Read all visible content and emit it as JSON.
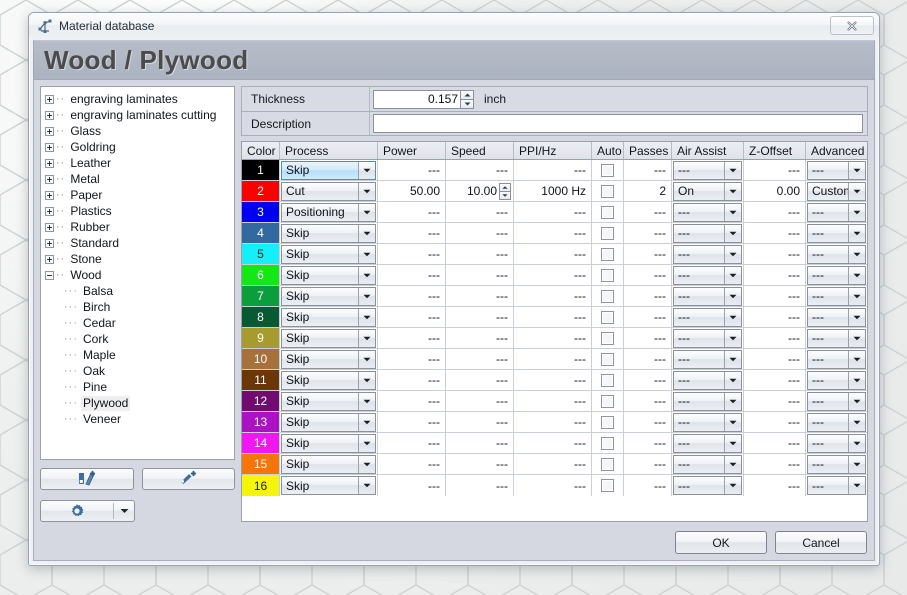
{
  "window": {
    "titlebar_text": "Material database",
    "titlebar_icon": "material-node-icon",
    "close_label": "Close",
    "close_icon": "close-x-icon"
  },
  "header": {
    "title": "Wood / Plywood"
  },
  "tree": {
    "roots": [
      {
        "label": "engraving laminates",
        "state": "collapsed"
      },
      {
        "label": "engraving laminates cutting",
        "state": "collapsed"
      },
      {
        "label": "Glass",
        "state": "collapsed"
      },
      {
        "label": "Goldring",
        "state": "collapsed"
      },
      {
        "label": "Leather",
        "state": "collapsed"
      },
      {
        "label": "Metal",
        "state": "collapsed"
      },
      {
        "label": "Paper",
        "state": "collapsed"
      },
      {
        "label": "Plastics",
        "state": "collapsed"
      },
      {
        "label": "Rubber",
        "state": "collapsed"
      },
      {
        "label": "Standard",
        "state": "collapsed"
      },
      {
        "label": "Stone",
        "state": "collapsed"
      },
      {
        "label": "Wood",
        "state": "expanded"
      }
    ],
    "children": [
      {
        "label": "Balsa",
        "selected": false
      },
      {
        "label": "Birch",
        "selected": false
      },
      {
        "label": "Cedar",
        "selected": false
      },
      {
        "label": "Cork",
        "selected": false
      },
      {
        "label": "Maple",
        "selected": false
      },
      {
        "label": "Oak",
        "selected": false
      },
      {
        "label": "Pine",
        "selected": false
      },
      {
        "label": "Plywood",
        "selected": true
      },
      {
        "label": "Veneer",
        "selected": false
      }
    ]
  },
  "left_buttons": {
    "new_material_icon": "new-material-icon",
    "new_setting_icon": "new-setting-icon",
    "options_icon": "gear-icon",
    "options_dropdown_icon": "chevron-down-icon"
  },
  "form": {
    "thickness_label": "Thickness",
    "thickness_value": "0.157",
    "thickness_unit": "inch",
    "description_label": "Description",
    "description_value": "",
    "spinner_up_icon": "spinner-up-icon",
    "spinner_down_icon": "spinner-down-icon"
  },
  "grid": {
    "columns": [
      "Color",
      "Process",
      "Power",
      "Speed",
      "PPI/Hz",
      "Auto",
      "Passes",
      "Air Assist",
      "Z-Offset",
      "Advanced"
    ],
    "placeholder": "---",
    "rows": [
      {
        "index": "1",
        "color": "#000000",
        "text_color": "#ffffff",
        "process": "Skip",
        "process_selected": true,
        "power": "---",
        "speed": "---",
        "speed_spinner": false,
        "ppi": "---",
        "auto": false,
        "passes": "---",
        "air_assist": "---",
        "z_offset": "---",
        "advanced": "---"
      },
      {
        "index": "2",
        "color": "#fa0000",
        "text_color": "#ffffff",
        "process": "Cut",
        "process_selected": false,
        "power": "50.00",
        "speed": "10.00",
        "speed_spinner": true,
        "ppi": "1000 Hz",
        "auto": false,
        "passes": "2",
        "air_assist": "On",
        "z_offset": "0.00",
        "advanced": "Custom"
      },
      {
        "index": "3",
        "color": "#0000f0",
        "text_color": "#ffffff",
        "process": "Positioning",
        "process_selected": false,
        "power": "---",
        "speed": "---",
        "speed_spinner": false,
        "ppi": "---",
        "auto": false,
        "passes": "---",
        "air_assist": "---",
        "z_offset": "---",
        "advanced": "---"
      },
      {
        "index": "4",
        "color": "#33699e",
        "text_color": "#ffffff",
        "process": "Skip",
        "process_selected": false,
        "power": "---",
        "speed": "---",
        "speed_spinner": false,
        "ppi": "---",
        "auto": false,
        "passes": "---",
        "air_assist": "---",
        "z_offset": "---",
        "advanced": "---"
      },
      {
        "index": "5",
        "color": "#15eff7",
        "text_color": "#222222",
        "process": "Skip",
        "process_selected": false,
        "power": "---",
        "speed": "---",
        "speed_spinner": false,
        "ppi": "---",
        "auto": false,
        "passes": "---",
        "air_assist": "---",
        "z_offset": "---",
        "advanced": "---"
      },
      {
        "index": "6",
        "color": "#13e716",
        "text_color": "#ffffff",
        "process": "Skip",
        "process_selected": false,
        "power": "---",
        "speed": "---",
        "speed_spinner": false,
        "ppi": "---",
        "auto": false,
        "passes": "---",
        "air_assist": "---",
        "z_offset": "---",
        "advanced": "---"
      },
      {
        "index": "7",
        "color": "#0c9e3c",
        "text_color": "#ffffff",
        "process": "Skip",
        "process_selected": false,
        "power": "---",
        "speed": "---",
        "speed_spinner": false,
        "ppi": "---",
        "auto": false,
        "passes": "---",
        "air_assist": "---",
        "z_offset": "---",
        "advanced": "---"
      },
      {
        "index": "8",
        "color": "#085a33",
        "text_color": "#ffffff",
        "process": "Skip",
        "process_selected": false,
        "power": "---",
        "speed": "---",
        "speed_spinner": false,
        "ppi": "---",
        "auto": false,
        "passes": "---",
        "air_assist": "---",
        "z_offset": "---",
        "advanced": "---"
      },
      {
        "index": "9",
        "color": "#a79b2e",
        "text_color": "#ffffff",
        "process": "Skip",
        "process_selected": false,
        "power": "---",
        "speed": "---",
        "speed_spinner": false,
        "ppi": "---",
        "auto": false,
        "passes": "---",
        "air_assist": "---",
        "z_offset": "---",
        "advanced": "---"
      },
      {
        "index": "10",
        "color": "#a7713c",
        "text_color": "#ffffff",
        "process": "Skip",
        "process_selected": false,
        "power": "---",
        "speed": "---",
        "speed_spinner": false,
        "ppi": "---",
        "auto": false,
        "passes": "---",
        "air_assist": "---",
        "z_offset": "---",
        "advanced": "---"
      },
      {
        "index": "11",
        "color": "#6b3708",
        "text_color": "#ffffff",
        "process": "Skip",
        "process_selected": false,
        "power": "---",
        "speed": "---",
        "speed_spinner": false,
        "ppi": "---",
        "auto": false,
        "passes": "---",
        "air_assist": "---",
        "z_offset": "---",
        "advanced": "---"
      },
      {
        "index": "12",
        "color": "#710a71",
        "text_color": "#ffffff",
        "process": "Skip",
        "process_selected": false,
        "power": "---",
        "speed": "---",
        "speed_spinner": false,
        "ppi": "---",
        "auto": false,
        "passes": "---",
        "air_assist": "---",
        "z_offset": "---",
        "advanced": "---"
      },
      {
        "index": "13",
        "color": "#ad11c4",
        "text_color": "#ffffff",
        "process": "Skip",
        "process_selected": false,
        "power": "---",
        "speed": "---",
        "speed_spinner": false,
        "ppi": "---",
        "auto": false,
        "passes": "---",
        "air_assist": "---",
        "z_offset": "---",
        "advanced": "---"
      },
      {
        "index": "14",
        "color": "#f018f0",
        "text_color": "#ffffff",
        "process": "Skip",
        "process_selected": false,
        "power": "---",
        "speed": "---",
        "speed_spinner": false,
        "ppi": "---",
        "auto": false,
        "passes": "---",
        "air_assist": "---",
        "z_offset": "---",
        "advanced": "---"
      },
      {
        "index": "15",
        "color": "#f57508",
        "text_color": "#ffffff",
        "process": "Skip",
        "process_selected": false,
        "power": "---",
        "speed": "---",
        "speed_spinner": false,
        "ppi": "---",
        "auto": false,
        "passes": "---",
        "air_assist": "---",
        "z_offset": "---",
        "advanced": "---"
      },
      {
        "index": "16",
        "color": "#f5f50a",
        "text_color": "#222222",
        "process": "Skip",
        "process_selected": false,
        "power": "---",
        "speed": "---",
        "speed_spinner": false,
        "ppi": "---",
        "auto": false,
        "passes": "---",
        "air_assist": "---",
        "z_offset": "---",
        "advanced": "---"
      }
    ]
  },
  "footer": {
    "ok_label": "OK",
    "cancel_label": "Cancel"
  }
}
